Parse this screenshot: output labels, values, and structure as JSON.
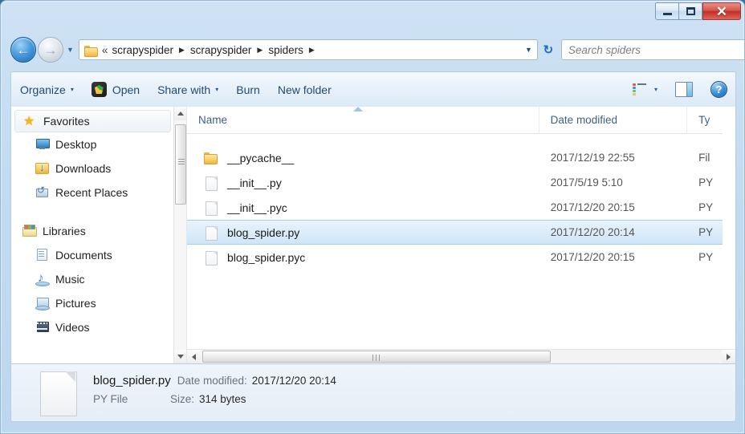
{
  "window": {
    "controls": {
      "minimize": "–",
      "maximize": "□",
      "close": "✕"
    }
  },
  "nav": {
    "back_icon": "←",
    "forward_icon": "→",
    "history_caret": "▼",
    "breadcrumb": {
      "leading": "«",
      "items": [
        "scrapyspider",
        "scrapyspider",
        "spiders"
      ],
      "separator": "▶",
      "trailing_separator": "▶"
    },
    "address_caret": "▼",
    "refresh_icon": "↻"
  },
  "search": {
    "placeholder": "Search spiders"
  },
  "toolbar": {
    "organize": "Organize",
    "organize_caret": "▾",
    "open": "Open",
    "share_with": "Share with",
    "share_caret": "▾",
    "burn": "Burn",
    "new_folder": "New folder",
    "view_caret": "▾",
    "help": "?"
  },
  "sidebar": {
    "groups": [
      {
        "header": {
          "label": "Favorites",
          "icon": "star-icon",
          "selected": true
        },
        "items": [
          {
            "label": "Desktop",
            "icon": "desktop-icon"
          },
          {
            "label": "Downloads",
            "icon": "downloads-folder-icon"
          },
          {
            "label": "Recent Places",
            "icon": "recent-places-icon"
          }
        ]
      },
      {
        "header": {
          "label": "Libraries",
          "icon": "libraries-icon",
          "selected": false
        },
        "items": [
          {
            "label": "Documents",
            "icon": "documents-icon"
          },
          {
            "label": "Music",
            "icon": "music-icon"
          },
          {
            "label": "Pictures",
            "icon": "pictures-icon"
          },
          {
            "label": "Videos",
            "icon": "videos-icon"
          }
        ]
      }
    ]
  },
  "filelist": {
    "columns": [
      "Name",
      "Date modified",
      "Ty"
    ],
    "rows": [
      {
        "name": "__pycache__",
        "date": "2017/12/19 22:55",
        "type": "Fil",
        "icon": "folder-icon",
        "selected": false
      },
      {
        "name": "__init__.py",
        "date": "2017/5/19 5:10",
        "type": "PY",
        "icon": "file-icon",
        "selected": false
      },
      {
        "name": "__init__.pyc",
        "date": "2017/12/20 20:15",
        "type": "PY",
        "icon": "file-icon",
        "selected": false
      },
      {
        "name": "blog_spider.py",
        "date": "2017/12/20 20:14",
        "type": "PY",
        "icon": "file-icon",
        "selected": true
      },
      {
        "name": "blog_spider.pyc",
        "date": "2017/12/20 20:15",
        "type": "PY",
        "icon": "file-icon",
        "selected": false
      }
    ]
  },
  "statusbar": {
    "file_name": "blog_spider.py",
    "date_label": "Date modified:",
    "date_value": "2017/12/20 20:14",
    "type_value": "PY File",
    "size_label": "Size:",
    "size_value": "314 bytes"
  },
  "colors": {
    "selection": "#cfe5f8",
    "close_button": "#bf2f26",
    "accent": "#2b6ca8",
    "folder": "#f8cf6a"
  }
}
